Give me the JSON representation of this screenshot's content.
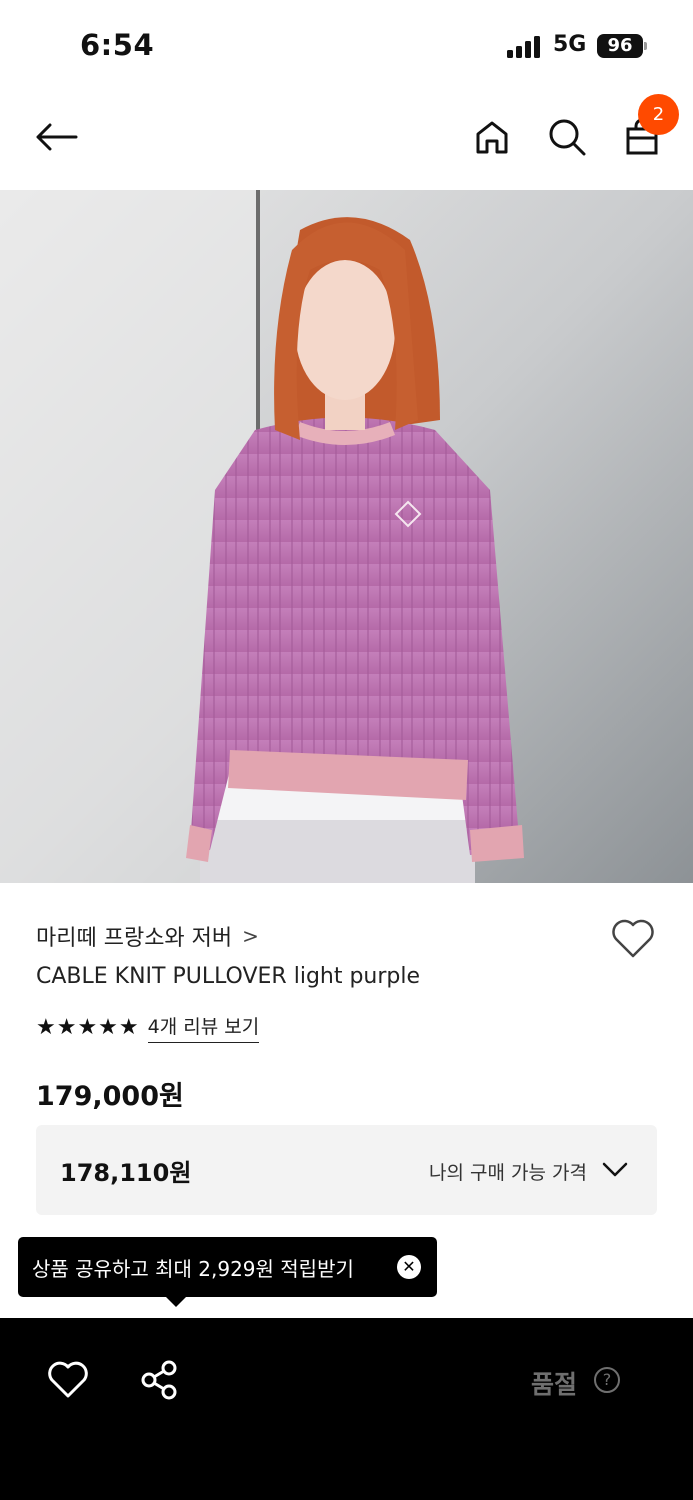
{
  "status_bar": {
    "time": "6:54",
    "network": "5G",
    "battery": "96"
  },
  "header": {
    "back_icon": "arrow-left-icon",
    "home_icon": "home-icon",
    "search_icon": "search-icon",
    "cart_icon": "shopping-bag-icon",
    "cart_count": "2",
    "badge_color": "#ff4a00"
  },
  "product": {
    "image_icon": "product-photo",
    "brand": "마리떼 프랑소와 저버",
    "brand_chevron": ">",
    "name": "CABLE KNIT PULLOVER light purple",
    "stars": "★★★★★",
    "review_link": "4개 리뷰 보기",
    "price": "179,000원",
    "my_price": {
      "value": "178,110원",
      "label": "나의 구매 가능 가격"
    }
  },
  "tooltip": {
    "text": "상품 공유하고 최대 2,929원 적립받기",
    "close": "✕"
  },
  "bottom_bar": {
    "wish_icon": "heart-icon",
    "share_icon": "share-icon",
    "status_label": "품절",
    "help": "?"
  }
}
